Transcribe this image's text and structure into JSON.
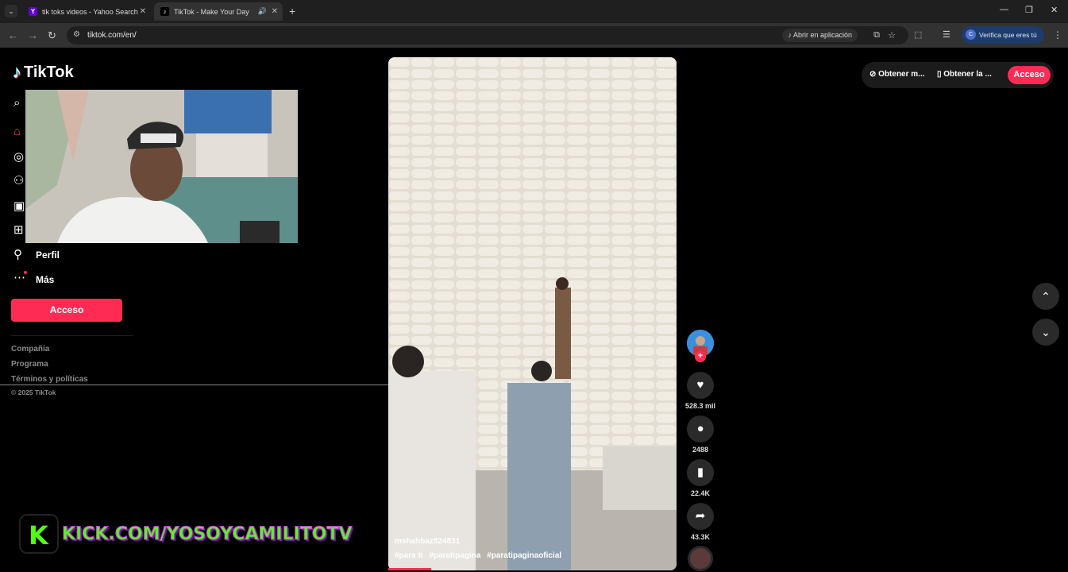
{
  "browser": {
    "tabs": [
      {
        "title": "tik toks videos - Yahoo Search",
        "favicon": "Y"
      },
      {
        "title": "TikTok - Make Your Day",
        "favicon": "♪"
      }
    ],
    "url": "tiktok.com/en/",
    "open_in_app": "Abrir en aplicación",
    "verify_label": "Verifica que eres tú",
    "profile_initial": "C"
  },
  "tiktok": {
    "brand": "TikTok",
    "sidebar": {
      "profile_label": "Perfil",
      "more_label": "Más",
      "login_button": "Acceso",
      "footer": [
        "Compañía",
        "Programa",
        "Términos y políticas"
      ],
      "copyright": "© 2025 TikTok"
    },
    "video": {
      "username": "mshahbaz824831",
      "hashtags": [
        "#para ti",
        "#paratipagina",
        "#paratipaginaoficial"
      ],
      "likes": "528.3 mil",
      "comments": "2488",
      "saves": "22.4K",
      "shares": "43.3K"
    },
    "topbar": {
      "item1": "Obtener m...",
      "item2": "Obtener la ...",
      "login": "Acceso"
    }
  },
  "overlay": {
    "kick_text": "KICK.COM/YOSOYCAMILITOTV",
    "kick_letter": "K"
  },
  "colors": {
    "brand_red": "#fe2c55",
    "kick_green": "#53fc18"
  }
}
